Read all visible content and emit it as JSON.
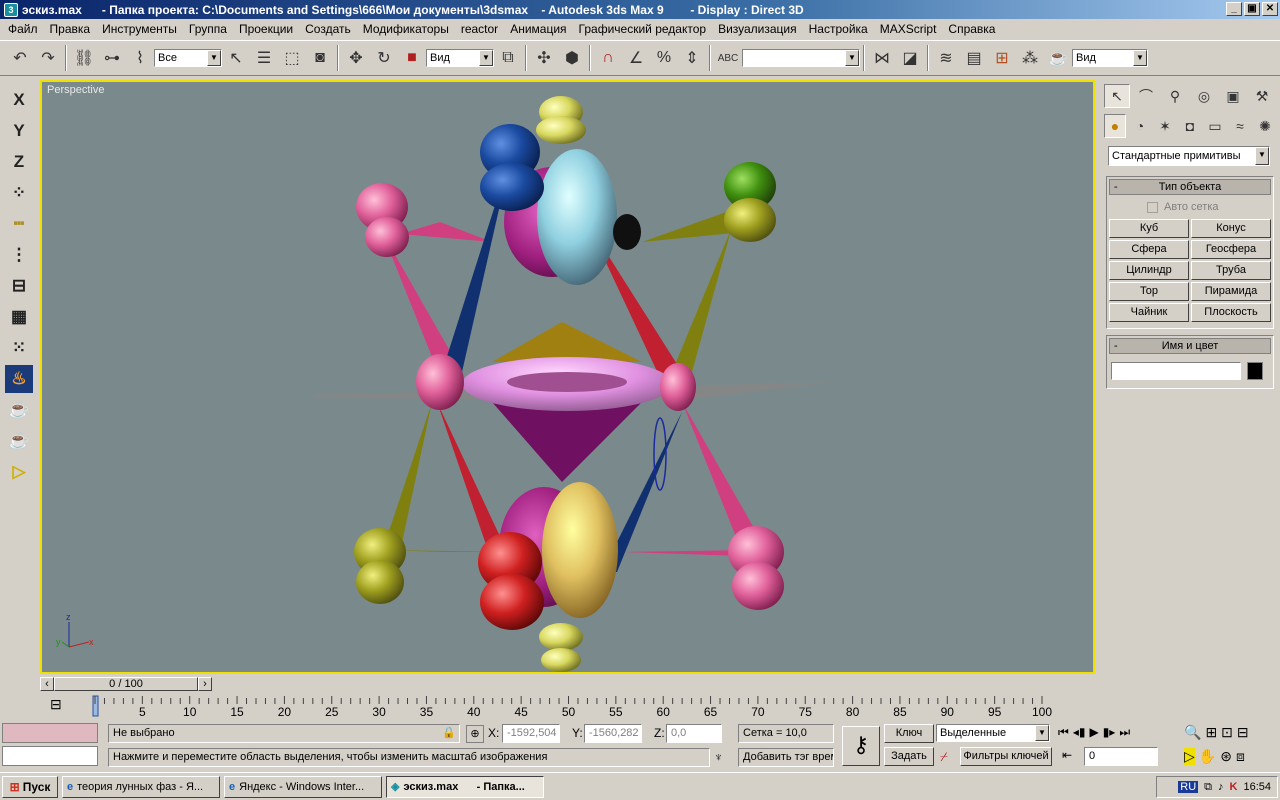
{
  "window": {
    "file": "эскиз.max",
    "project": "- Папка проекта: C:\\Documents and Settings\\666\\Мои документы\\3dsmax",
    "app": "- Autodesk 3ds Max 9",
    "display": "- Display : Direct 3D",
    "app_icon": "3",
    "min_label": "_",
    "max_label": "▣",
    "close_label": "✕"
  },
  "menu": [
    "Файл",
    "Правка",
    "Инструменты",
    "Группа",
    "Проекции",
    "Создать",
    "Модификаторы",
    "reactor",
    "Анимация",
    "Графический редактор",
    "Визуализация",
    "Настройка",
    "MAXScript",
    "Справка"
  ],
  "toolbar": {
    "selection_filter": "Все",
    "ref_coord": "Вид",
    "named_sel": "",
    "render_view": "Вид"
  },
  "left_tools": [
    "X",
    "Y",
    "Z"
  ],
  "viewport": {
    "label": "Perspective",
    "axis_x": "x",
    "axis_y": "y",
    "axis_z": "z"
  },
  "command_panel": {
    "category": "Стандартные примитивы",
    "object_type_title": "Тип объекта",
    "autogrid": "Авто сетка",
    "buttons": [
      "Куб",
      "Конус",
      "Сфера",
      "Геосфера",
      "Цилиндр",
      "Труба",
      "Тор",
      "Пирамида",
      "Чайник",
      "Плоскость"
    ],
    "name_color_title": "Имя и цвет",
    "name_value": "",
    "object_color": "#000000",
    "minus": "-"
  },
  "timeline": {
    "slider_label": "0 / 100",
    "ticks": [
      "5",
      "10",
      "15",
      "20",
      "25",
      "30",
      "35",
      "40",
      "45",
      "50",
      "55",
      "60",
      "65",
      "70",
      "75",
      "80",
      "85",
      "90",
      "95",
      "100"
    ]
  },
  "status": {
    "selection": "Не выбрано",
    "prompt": "Нажмите и переместите область выделения, чтобы изменить масштаб изображения",
    "x_label": "X:",
    "x_value": "-1592,504",
    "y_label": "Y:",
    "y_value": "-1560,282",
    "z_label": "Z:",
    "z_value": "0,0",
    "grid": "Сетка = 10,0",
    "add_tag": "Добавить тэг врем",
    "key_btn": "Ключ",
    "set_btn": "Задать",
    "key_mode": "Выделенные",
    "key_filters": "Фильтры ключей",
    "frame": "0"
  },
  "taskbar": {
    "start": "Пуск",
    "tasks": [
      "теория лунных фаз - Я...",
      "Яндекс - Windows Inter...",
      "эскиз.max      - Папка..."
    ],
    "lang": "RU",
    "clock": "16:54"
  }
}
